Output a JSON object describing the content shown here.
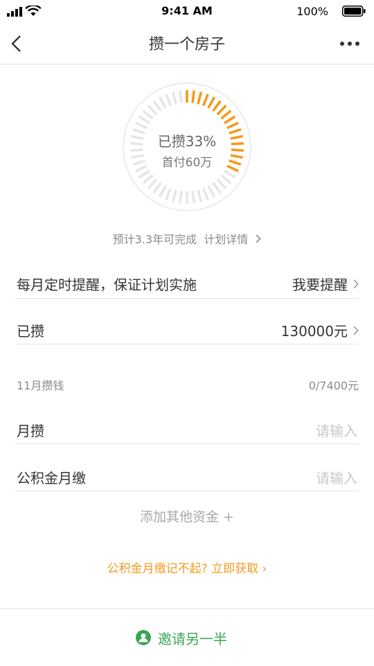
{
  "status_bar": {
    "time": "9:41 AM",
    "battery": "100%"
  },
  "nav": {
    "title": "攒一个房子"
  },
  "gauge": {
    "progress": 0.33,
    "line1": "已攒33%",
    "line2": "首付60万",
    "active_color": "#f39a1e",
    "inactive_color": "#e6e6e6"
  },
  "estimate": {
    "text": "预计3.3年可完成",
    "link": "计划详情"
  },
  "reminder": {
    "label": "每月定时提醒，保证计划实施",
    "action": "我要提醒"
  },
  "saved": {
    "label": "已攒",
    "value": "130000元"
  },
  "month_section": {
    "label": "11月攒钱",
    "value": "0/7400元"
  },
  "monthly_saving": {
    "label": "月攒",
    "placeholder": "请输入"
  },
  "housing_fund": {
    "label": "公积金月缴",
    "placeholder": "请输入"
  },
  "add_funds": "添加其他资金 +",
  "promo": "公积金月缴记不起?  立即获取 ›",
  "invite": "邀请另一半",
  "colors": {
    "accent": "#f39a1e",
    "green": "#3aa655"
  }
}
